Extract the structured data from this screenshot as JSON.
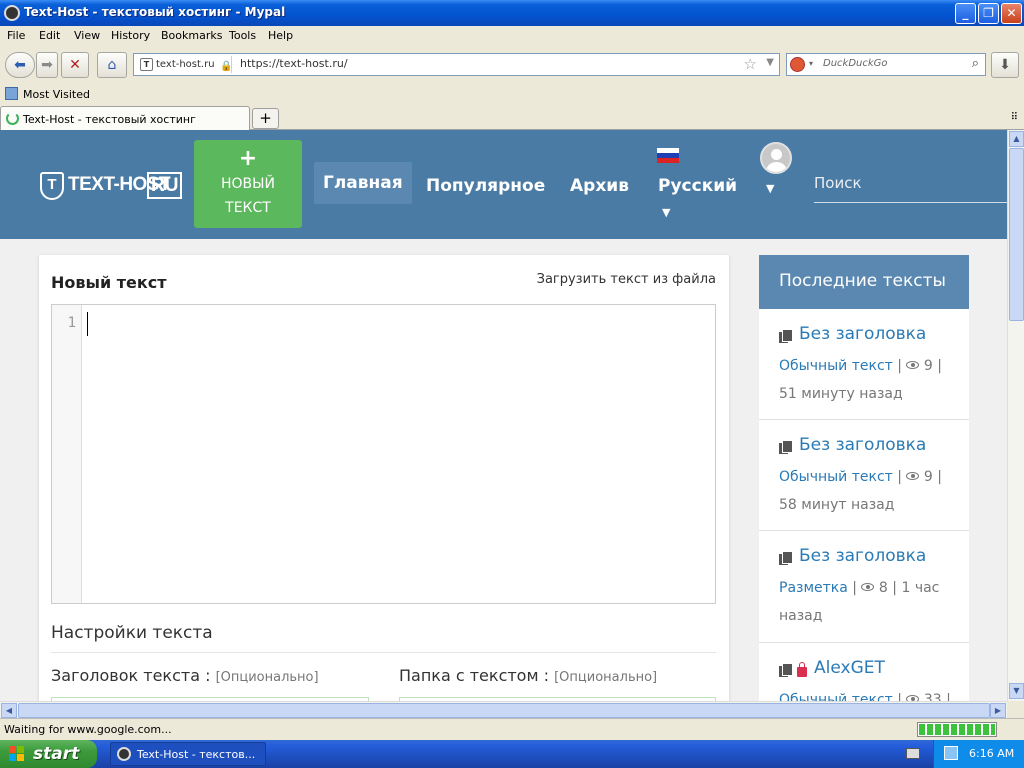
{
  "window": {
    "title": "Text-Host - текстовый хостинг - Mypal",
    "minimize": "_",
    "maximize": "❐",
    "close": "✕"
  },
  "menu": [
    "File",
    "Edit",
    "View",
    "History",
    "Bookmarks",
    "Tools",
    "Help"
  ],
  "nav": {
    "site_label": "text-host.ru",
    "site_icon": "T",
    "url": "https://text-host.ru/",
    "search_placeholder": "DuckDuckGo",
    "icons": [
      "back-icon",
      "forward-icon",
      "stop-icon",
      "home-icon",
      "star-icon",
      "search-icon",
      "download-icon"
    ]
  },
  "bookmarks": {
    "most_visited": "Most Visited"
  },
  "tabs": [
    {
      "label": "Text-Host - текстовый хостинг"
    }
  ],
  "site": {
    "logo_text": "TEXT-HOST",
    "logo_ru": "RU",
    "logo_mark": "T",
    "new_text_plus": "+",
    "new_text_line1": "НОВЫЙ",
    "new_text_line2": "ТЕКСТ",
    "nav_links": [
      "Главная",
      "Популярное",
      "Архив"
    ],
    "language": "Русский",
    "search_placeholder": "Поиск",
    "colors": {
      "header": "#4a7ba5",
      "new_button": "#5cb85c",
      "link": "#2a7ab5"
    }
  },
  "editor_panel": {
    "title": "Новый текст",
    "upload_link": "Загрузить текст из файла",
    "line_number": "1",
    "settings_title": "Настройки текста",
    "title_field_label": "Заголовок текста :",
    "title_field_optional": "[Опционально]",
    "folder_field_label": "Папка с текстом :",
    "folder_field_optional": "[Опционально]"
  },
  "sidebar": {
    "heading": "Последние тексты",
    "entries": [
      {
        "title": "Без заголовка",
        "category": "Обычный текст",
        "views": "9",
        "time": "51 минуту назад",
        "locked": false
      },
      {
        "title": "Без заголовка",
        "category": "Обычный текст",
        "views": "9",
        "time": "58 минут назад",
        "locked": false
      },
      {
        "title": "Без заголовка",
        "category": "Разметка",
        "views": "8",
        "time": "1 час назад",
        "locked": false
      },
      {
        "title": "AlexGET",
        "category": "Обычный текст",
        "views": "33",
        "time": "",
        "locked": true
      }
    ]
  },
  "status": {
    "text": "Waiting for www.google.com...",
    "progress": 1.0
  },
  "taskbar": {
    "start": "start",
    "task": "Text-Host - текстов...",
    "clock": "6:16 AM"
  }
}
